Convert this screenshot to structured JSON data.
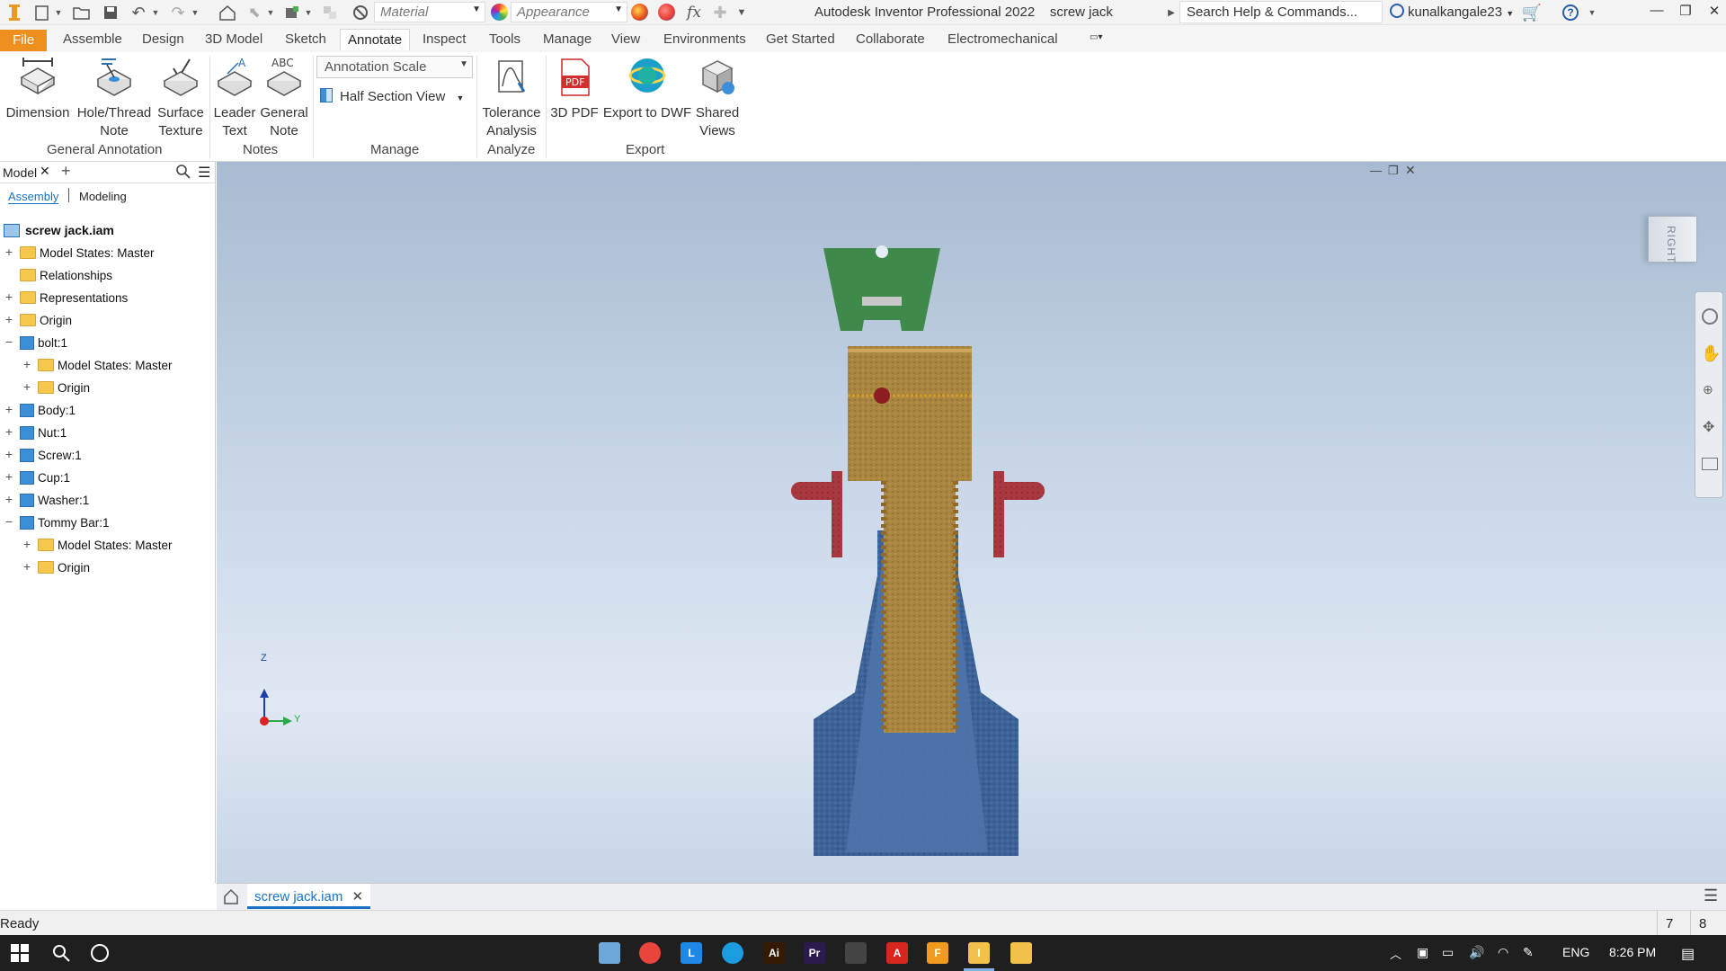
{
  "titlebar": {
    "app_title": "Autodesk Inventor Professional 2022",
    "doc_title": "screw jack",
    "material_placeholder": "Material",
    "appearance_placeholder": "Appearance",
    "fx_label": "fx",
    "search_text": "Search Help & Commands...",
    "user_name": "kunalkangale23",
    "help_label": "?"
  },
  "ribbon_tabs": [
    "File",
    "Assemble",
    "Design",
    "3D Model",
    "Sketch",
    "Annotate",
    "Inspect",
    "Tools",
    "Manage",
    "View",
    "Environments",
    "Get Started",
    "Collaborate",
    "Electromechanical"
  ],
  "ribbon_active_tab": "Annotate",
  "ribbon": {
    "dimension": "Dimension",
    "hole_thread_1": "Hole/Thread",
    "hole_thread_2": "Note",
    "surface_1": "Surface",
    "surface_2": "Texture",
    "leader_1": "Leader",
    "leader_2": "Text",
    "general_1": "General",
    "general_2": "Note",
    "annotation_scale": "Annotation Scale",
    "half_section": "Half Section View",
    "tolerance_1": "Tolerance",
    "tolerance_2": "Analysis",
    "pdf_3d": "3D PDF",
    "pdf_icon_text": "PDF",
    "export_dwf": "Export to DWF",
    "shared_1": "Shared",
    "shared_2": "Views",
    "abc_label": "ABC",
    "panels": {
      "general_annotation": "General Annotation",
      "notes": "Notes",
      "manage": "Manage",
      "analyze": "Analyze",
      "export": "Export"
    }
  },
  "browser": {
    "tab_model": "Model",
    "tab_assembly": "Assembly",
    "tab_modeling": "Modeling",
    "root": "screw jack.iam",
    "items": [
      {
        "label": "Model States: Master",
        "expander": "+",
        "icon": "folder"
      },
      {
        "label": "Relationships",
        "expander": "",
        "icon": "folder"
      },
      {
        "label": "Representations",
        "expander": "+",
        "icon": "folder"
      },
      {
        "label": "Origin",
        "expander": "+",
        "icon": "folder"
      },
      {
        "label": "bolt:1",
        "expander": "−",
        "icon": "part"
      },
      {
        "label": "Model States: Master",
        "expander": "+",
        "icon": "folder"
      },
      {
        "label": "Origin",
        "expander": "+",
        "icon": "folder"
      },
      {
        "label": "Body:1",
        "expander": "+",
        "icon": "part"
      },
      {
        "label": "Nut:1",
        "expander": "+",
        "icon": "part"
      },
      {
        "label": "Screw:1",
        "expander": "+",
        "icon": "part"
      },
      {
        "label": "Cup:1",
        "expander": "+",
        "icon": "part"
      },
      {
        "label": "Washer:1",
        "expander": "+",
        "icon": "part"
      },
      {
        "label": "Tommy Bar:1",
        "expander": "−",
        "icon": "part"
      },
      {
        "label": "Model States: Master",
        "expander": "+",
        "icon": "folder"
      },
      {
        "label": "Origin",
        "expander": "+",
        "icon": "folder"
      }
    ]
  },
  "viewport": {
    "viewcube_label": "RIGHT",
    "triad_z": "Z",
    "triad_y": "Y"
  },
  "doc_tab": "screw jack.iam",
  "status": {
    "text": "Ready",
    "num1": "7",
    "num2": "8"
  },
  "taskbar": {
    "lang": "ENG",
    "time": "8:26 PM",
    "pinned_icons": [
      "inventor-pen-icon",
      "chrome-icon",
      "l-app-icon",
      "edge-icon",
      "illustrator-icon",
      "premiere-icon",
      "steam-icon",
      "acrobat-icon",
      "f-app-icon",
      "inventor-icon",
      "file-explorer-icon"
    ],
    "pinned_colors": [
      "#6ea8d9",
      "#e8453c",
      "#1e88e5",
      "#1b9ce0",
      "#331a00",
      "#2b1a4f",
      "#444444",
      "#d8261e",
      "#f29a20",
      "#f3c14a",
      "#f3c14a"
    ],
    "app_letters": {
      "illustrator": "Ai",
      "premiere": "Pr",
      "acrobat": "A",
      "f_app": "F",
      "inventor": "I",
      "l_app": "L"
    }
  },
  "colors": {
    "file_tab": "#ef8f1d",
    "accent": "#1a73c7",
    "body_blue": "#3b5f93",
    "screw_brass": "#a9833e",
    "nut_red": "#a8383f",
    "cup_green": "#3f8a4a"
  }
}
